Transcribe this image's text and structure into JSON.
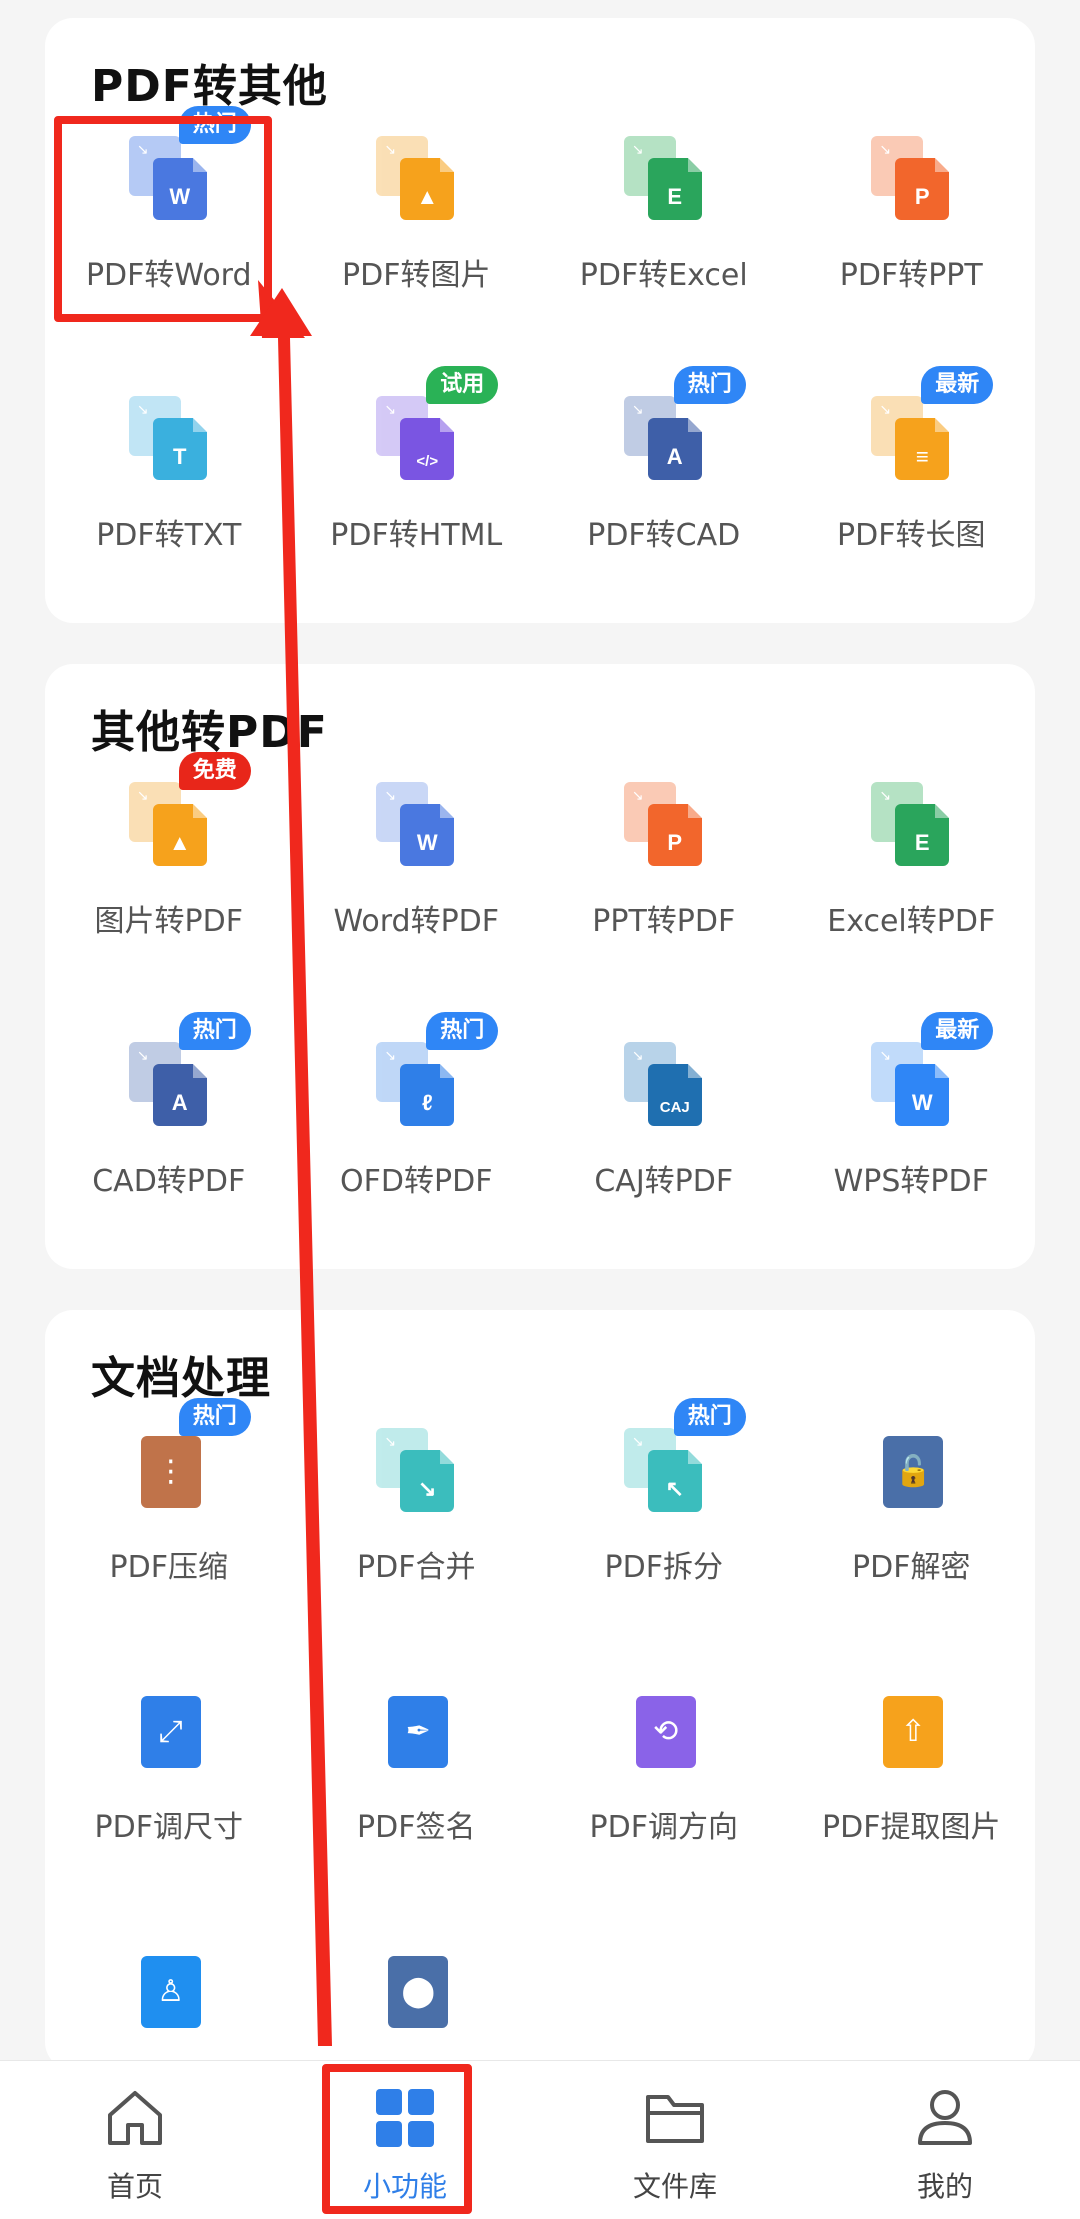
{
  "sections": [
    {
      "title": "PDF转其他",
      "tools": [
        {
          "label": "PDF转Word",
          "icon": "pdf-to-word-icon",
          "color": "#4a78e0",
          "back": "#7aa0ee",
          "glyph": "W",
          "badge": "热门",
          "badge_color": "#2f86f6"
        },
        {
          "label": "PDF转图片",
          "icon": "pdf-to-image-icon",
          "color": "#f6a21c",
          "back": "#f7c67a",
          "glyph": "▲",
          "badge": "",
          "badge_color": ""
        },
        {
          "label": "PDF转Excel",
          "icon": "pdf-to-excel-icon",
          "color": "#2aa55c",
          "back": "#79cc94",
          "glyph": "E",
          "badge": "",
          "badge_color": ""
        },
        {
          "label": "PDF转PPT",
          "icon": "pdf-to-ppt-icon",
          "color": "#f2662c",
          "back": "#f6a07a",
          "glyph": "P",
          "badge": "",
          "badge_color": ""
        },
        {
          "label": "PDF转TXT",
          "icon": "pdf-to-txt-icon",
          "color": "#3ab0de",
          "back": "#8fd0ee",
          "glyph": "T",
          "badge": "",
          "badge_color": ""
        },
        {
          "label": "PDF转HTML",
          "icon": "pdf-to-html-icon",
          "color": "#7a55e2",
          "back": "#b29ef0",
          "glyph": "</>",
          "badge": "试用",
          "badge_color": "#2ab256"
        },
        {
          "label": "PDF转CAD",
          "icon": "pdf-to-cad-icon",
          "color": "#3e5fa8",
          "back": "#8ea3cf",
          "glyph": "A",
          "badge": "热门",
          "badge_color": "#2f86f6"
        },
        {
          "label": "PDF转长图",
          "icon": "pdf-to-long-image-icon",
          "color": "#f6a21c",
          "back": "#f7c67a",
          "glyph": "≡",
          "badge": "最新",
          "badge_color": "#2f86f6"
        }
      ]
    },
    {
      "title": "其他转PDF",
      "tools": [
        {
          "label": "图片转PDF",
          "icon": "image-to-pdf-icon",
          "color": "#f6a21c",
          "back": "#f7c67a",
          "glyph": "▲",
          "badge": "免费",
          "badge_color": "#e8261a"
        },
        {
          "label": "Word转PDF",
          "icon": "word-to-pdf-icon",
          "color": "#4a78e0",
          "back": "#9db7f0",
          "glyph": "W",
          "badge": "",
          "badge_color": ""
        },
        {
          "label": "PPT转PDF",
          "icon": "ppt-to-pdf-icon",
          "color": "#f2662c",
          "back": "#f6a07a",
          "glyph": "P",
          "badge": "",
          "badge_color": ""
        },
        {
          "label": "Excel转PDF",
          "icon": "excel-to-pdf-icon",
          "color": "#2aa55c",
          "back": "#79cc94",
          "glyph": "E",
          "badge": "",
          "badge_color": ""
        },
        {
          "label": "CAD转PDF",
          "icon": "cad-to-pdf-icon",
          "color": "#3e5fa8",
          "back": "#8ea3cf",
          "glyph": "A",
          "badge": "热门",
          "badge_color": "#2f86f6"
        },
        {
          "label": "OFD转PDF",
          "icon": "ofd-to-pdf-icon",
          "color": "#2f7fe8",
          "back": "#8bb8f2",
          "glyph": "ℓ",
          "badge": "热门",
          "badge_color": "#2f86f6"
        },
        {
          "label": "CAJ转PDF",
          "icon": "caj-to-pdf-icon",
          "color": "#1f6fb0",
          "back": "#7fb0d8",
          "glyph": "CAJ",
          "badge": "",
          "badge_color": ""
        },
        {
          "label": "WPS转PDF",
          "icon": "wps-to-pdf-icon",
          "color": "#2f86f6",
          "back": "#8fbff6",
          "glyph": "W",
          "badge": "最新",
          "badge_color": "#2f86f6"
        }
      ]
    },
    {
      "title": "文档处理",
      "tools": [
        {
          "label": "PDF压缩",
          "icon": "pdf-compress-icon",
          "color": "#c0734a",
          "back": "",
          "glyph": "⋮",
          "badge": "热门",
          "badge_color": "#2f86f6"
        },
        {
          "label": "PDF合并",
          "icon": "pdf-merge-icon",
          "color": "#3bbdbd",
          "back": "#8edcdc",
          "glyph": "↘",
          "badge": "",
          "badge_color": ""
        },
        {
          "label": "PDF拆分",
          "icon": "pdf-split-icon",
          "color": "#3bbdbd",
          "back": "#8edcdc",
          "glyph": "↖",
          "badge": "热门",
          "badge_color": "#2f86f6"
        },
        {
          "label": "PDF解密",
          "icon": "pdf-decrypt-icon",
          "color": "#4a6fa8",
          "back": "",
          "glyph": "🔓",
          "badge": "",
          "badge_color": ""
        },
        {
          "label": "PDF调尺寸",
          "icon": "pdf-resize-icon",
          "color": "#2f7fe8",
          "back": "",
          "glyph": "⤢",
          "badge": "",
          "badge_color": ""
        },
        {
          "label": "PDF签名",
          "icon": "pdf-sign-icon",
          "color": "#2f7fe8",
          "back": "",
          "glyph": "✒",
          "badge": "",
          "badge_color": ""
        },
        {
          "label": "PDF调方向",
          "icon": "pdf-rotate-icon",
          "color": "#8a63e8",
          "back": "",
          "glyph": "⟲",
          "badge": "",
          "badge_color": ""
        },
        {
          "label": "PDF提取图片",
          "icon": "pdf-extract-image-icon",
          "color": "#f6a21c",
          "back": "",
          "glyph": "⇧",
          "badge": "",
          "badge_color": ""
        },
        {
          "label": "",
          "icon": "pdf-stamp-icon",
          "color": "#1f8ff0",
          "back": "",
          "glyph": "♙",
          "badge": "",
          "badge_color": ""
        },
        {
          "label": "",
          "icon": "pdf-encrypt-icon",
          "color": "#4a6fa8",
          "back": "",
          "glyph": "⬤",
          "badge": "",
          "badge_color": ""
        }
      ]
    }
  ],
  "bottom_nav": [
    {
      "label": "首页",
      "icon": "home-icon",
      "active": false
    },
    {
      "label": "小功能",
      "icon": "grid-apps-icon",
      "active": true
    },
    {
      "label": "文件库",
      "icon": "folder-icon",
      "active": false
    },
    {
      "label": "我的",
      "icon": "profile-icon",
      "active": false
    }
  ],
  "colors": {
    "accent": "#2f7fe8",
    "annotation": "#f0281d"
  }
}
